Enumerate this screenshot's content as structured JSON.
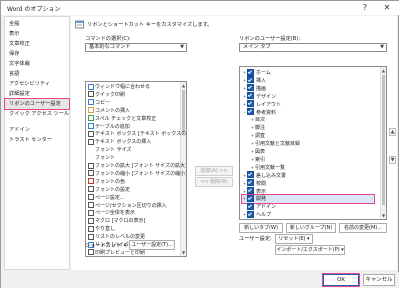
{
  "window": {
    "title": "Word のオプション",
    "help_glyph": "?",
    "close_glyph": "✕"
  },
  "nav": {
    "items": [
      "全般",
      "表示",
      "文章校正",
      "保存",
      "文字体裁",
      "言語",
      "アクセシビリティ",
      "詳細設定",
      "リボンのユーザー設定",
      "クイック アクセス ツール バー",
      "アドイン",
      "トラスト センター"
    ],
    "selected_index": 8
  },
  "header": {
    "text": "リボンとショートカット キーをカスタマイズします。"
  },
  "left": {
    "label": "コマンドの選択(C):",
    "combo_value": "基本的なコマンド",
    "items": [
      "ウィンドウ幅に合わせる",
      "クイック印刷",
      "コピー",
      "コメントの挿入",
      "スペル チェックと文章校正",
      "テーブルの追加",
      "テキスト ボックス [テキスト ボックスの描画]",
      "テキスト ボックスの挿入",
      "フォント サイズ",
      "フォント",
      "フォントの拡大 [フォント サイズの拡大]",
      "フォントの縮小 [フォント サイズの縮小]",
      "フォントの色",
      "フォントの設定",
      "ページ設定...",
      "ページ/セクション区切りの挿入",
      "ページ全体を表示",
      "マクロ [マクロの表示]",
      "やり直し",
      "リストのレベルの変更",
      "リンク [ハイパーリンクの追加]",
      "印刷プレビューと印刷"
    ]
  },
  "middle": {
    "add_button": "追加(A) >>",
    "remove_button": "<< 削除(R)"
  },
  "right": {
    "label": "リボンのユーザー設定(B):",
    "combo_value": "メイン タブ",
    "tree": [
      {
        "label": "ホーム",
        "level": 0,
        "toggle": "+",
        "check": true
      },
      {
        "label": "挿入",
        "level": 0,
        "toggle": "+",
        "check": true
      },
      {
        "label": "描画",
        "level": 0,
        "toggle": "+",
        "check": true
      },
      {
        "label": "デザイン",
        "level": 0,
        "toggle": "+",
        "check": true
      },
      {
        "label": "レイアウト",
        "level": 0,
        "toggle": "+",
        "check": true
      },
      {
        "label": "参考資料",
        "level": 0,
        "toggle": "−",
        "check": true
      },
      {
        "label": "目次",
        "level": 1,
        "toggle": "+",
        "check": false
      },
      {
        "label": "脚注",
        "level": 1,
        "toggle": "+",
        "check": false
      },
      {
        "label": "調査",
        "level": 1,
        "toggle": "+",
        "check": false
      },
      {
        "label": "引用文献と文献目録",
        "level": 1,
        "toggle": "+",
        "check": false
      },
      {
        "label": "図表",
        "level": 1,
        "toggle": "+",
        "check": false
      },
      {
        "label": "索引",
        "level": 1,
        "toggle": "+",
        "check": false
      },
      {
        "label": "引用文献一覧",
        "level": 1,
        "toggle": "+",
        "check": false
      },
      {
        "label": "差し込み文書",
        "level": 0,
        "toggle": "+",
        "check": true
      },
      {
        "label": "校閲",
        "level": 0,
        "toggle": "+",
        "check": true
      },
      {
        "label": "表示",
        "level": 0,
        "toggle": "+",
        "check": true
      },
      {
        "label": "開発",
        "level": 0,
        "toggle": "+",
        "check": true,
        "highlight": true
      },
      {
        "label": "アドイン",
        "level": 0,
        "toggle": "",
        "check": true
      },
      {
        "label": "ヘルプ",
        "level": 0,
        "toggle": "+",
        "check": true
      }
    ],
    "new_tab_button": "新しいタブ(W)",
    "new_group_button": "新しいグループ(N)",
    "rename_button": "名前の変更(M)...",
    "user_settings_label": "ユーザー設定:",
    "reset_button": "リセット(E) ▾",
    "import_export_button": "インポート/エクスポート(P) ▾"
  },
  "shortcut": {
    "label": "ショートカット キー:",
    "button": "ユーザー設定(T)..."
  },
  "footer": {
    "ok": "OK",
    "cancel": "キャンセル"
  },
  "colors": {
    "highlight": "#e44a8d",
    "check_blue": "#1a5fb4"
  }
}
